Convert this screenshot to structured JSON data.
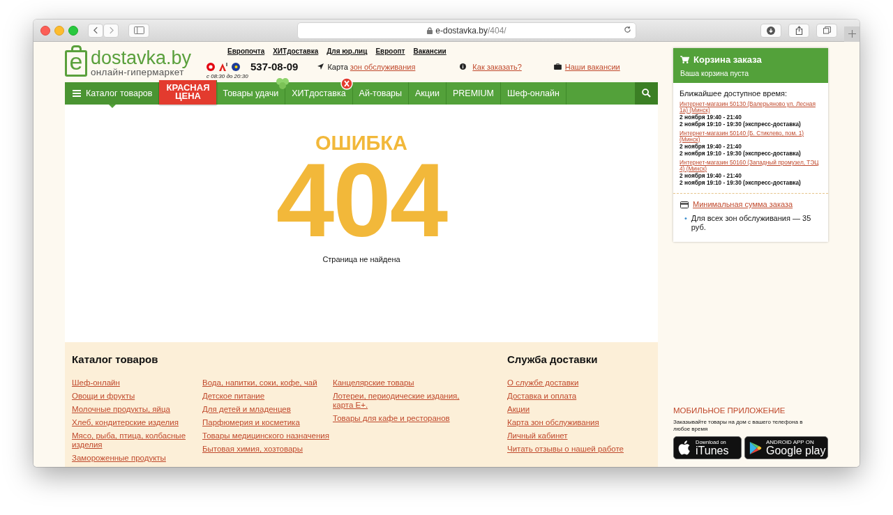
{
  "browser": {
    "url_host": "e-dostavka.by",
    "url_path": "/404/"
  },
  "header": {
    "logo": {
      "letter": "e",
      "name": "dostavka.by",
      "tagline": "онлайн-гипермаркет"
    },
    "top_links": [
      "Европочта",
      "ХИТдоставка",
      "Для юр.лиц",
      "Евроопт",
      "Вакансии"
    ],
    "phone": {
      "number": "537-08-09",
      "hours": "с 08:30 до 20:30"
    },
    "map": {
      "prefix": "Карта",
      "link": "зон обслуживания"
    },
    "how_to_order": "Как заказать?",
    "vacancies": "Наши вакансии"
  },
  "nav": {
    "items": [
      {
        "label": "Каталог товаров",
        "kind": "menu",
        "selected": true
      },
      {
        "label": "КРАСНАЯ",
        "label_2": "ЦЕНА",
        "kind": "promo",
        "selected": false
      },
      {
        "label": "Товары удачи",
        "kind": "clover",
        "selected": false
      },
      {
        "label": "ХИТдоставка",
        "kind": "cross",
        "selected": false
      },
      {
        "label": "Ай-товары",
        "kind": "link",
        "selected": false
      },
      {
        "label": "Акции",
        "kind": "link",
        "selected": false
      },
      {
        "label": "PREMIUM",
        "kind": "link",
        "selected": false
      },
      {
        "label": "Шеф-онлайн",
        "kind": "link",
        "selected": false
      }
    ]
  },
  "error": {
    "title": "ОШИБКА",
    "code": "404",
    "message": "Страница не найдена"
  },
  "cart": {
    "title": "Корзина заказа",
    "subtitle": "Ваша корзина пуста",
    "time_heading": "Ближайшее доступное время:",
    "stores": [
      {
        "link": "Интернет-магазин 50130 (Валерьяново ул. Лесная 1а) (Минск)",
        "times": [
          {
            "text": "2 ноября 19:40 - 21:40"
          },
          {
            "text": "2 ноября 19:10 - 19:30",
            "note": "(экспресс-доставка)"
          }
        ]
      },
      {
        "link": "Интернет-магазин 50140 (Б. Стиклево, пом. 1) (Минск)",
        "times": [
          {
            "text": "2 ноября 19:40 - 21:40"
          },
          {
            "text": "2 ноября 19:10 - 19:30",
            "note": "(экспресс-доставка)"
          }
        ]
      },
      {
        "link": "Интернет-магазин 50160 (Западный промузел, ТЭЦ 4) (Минск)",
        "times": [
          {
            "text": "2 ноября 19:40 - 21:40"
          },
          {
            "text": "2 ноября 19:10 - 19:30",
            "note": "(экспресс-доставка)"
          }
        ]
      }
    ],
    "minimum": {
      "link": "Минимальная сумма заказа",
      "bullet": "•",
      "items": [
        "Для всех зон обслуживания — 35 руб."
      ]
    }
  },
  "footer": {
    "catalog": {
      "heading": "Каталог товаров",
      "columns": [
        [
          "Шеф-онлайн",
          "Овощи и фрукты",
          "Молочные продукты, яйца",
          "Хлеб, кондитерские изделия",
          "Мясо, рыба, птица, колбасные изделия",
          "Замороженные продукты"
        ],
        [
          "Вода, напитки, соки, кофе, чай",
          "Детское питание",
          "Для детей и младенцев",
          "Парфюмерия и косметика",
          "Товары медицинского назначения",
          "Бытовая химия, хозтовары"
        ],
        [
          "Канцелярские товары",
          "Лотереи, периодические издания, карта Е+.",
          "Товары для кафе и ресторанов"
        ]
      ]
    },
    "delivery": {
      "heading": "Служба доставки",
      "links": [
        "О службе доставки",
        "Доставка и оплата",
        "Акции",
        "Карта зон обслуживания",
        "Личный кабинет",
        "Читать отзывы о нашей работе"
      ]
    }
  },
  "app": {
    "heading": "МОБИЛЬНОЕ ПРИЛОЖЕНИЕ",
    "text": "Заказывайте товары на дом с вашего телефона в любое время",
    "stores": [
      {
        "kind": "apple",
        "small": "Download on",
        "big": "iTunes"
      },
      {
        "kind": "google",
        "small": "ANDROID APP ON",
        "big": "Google play"
      }
    ]
  }
}
